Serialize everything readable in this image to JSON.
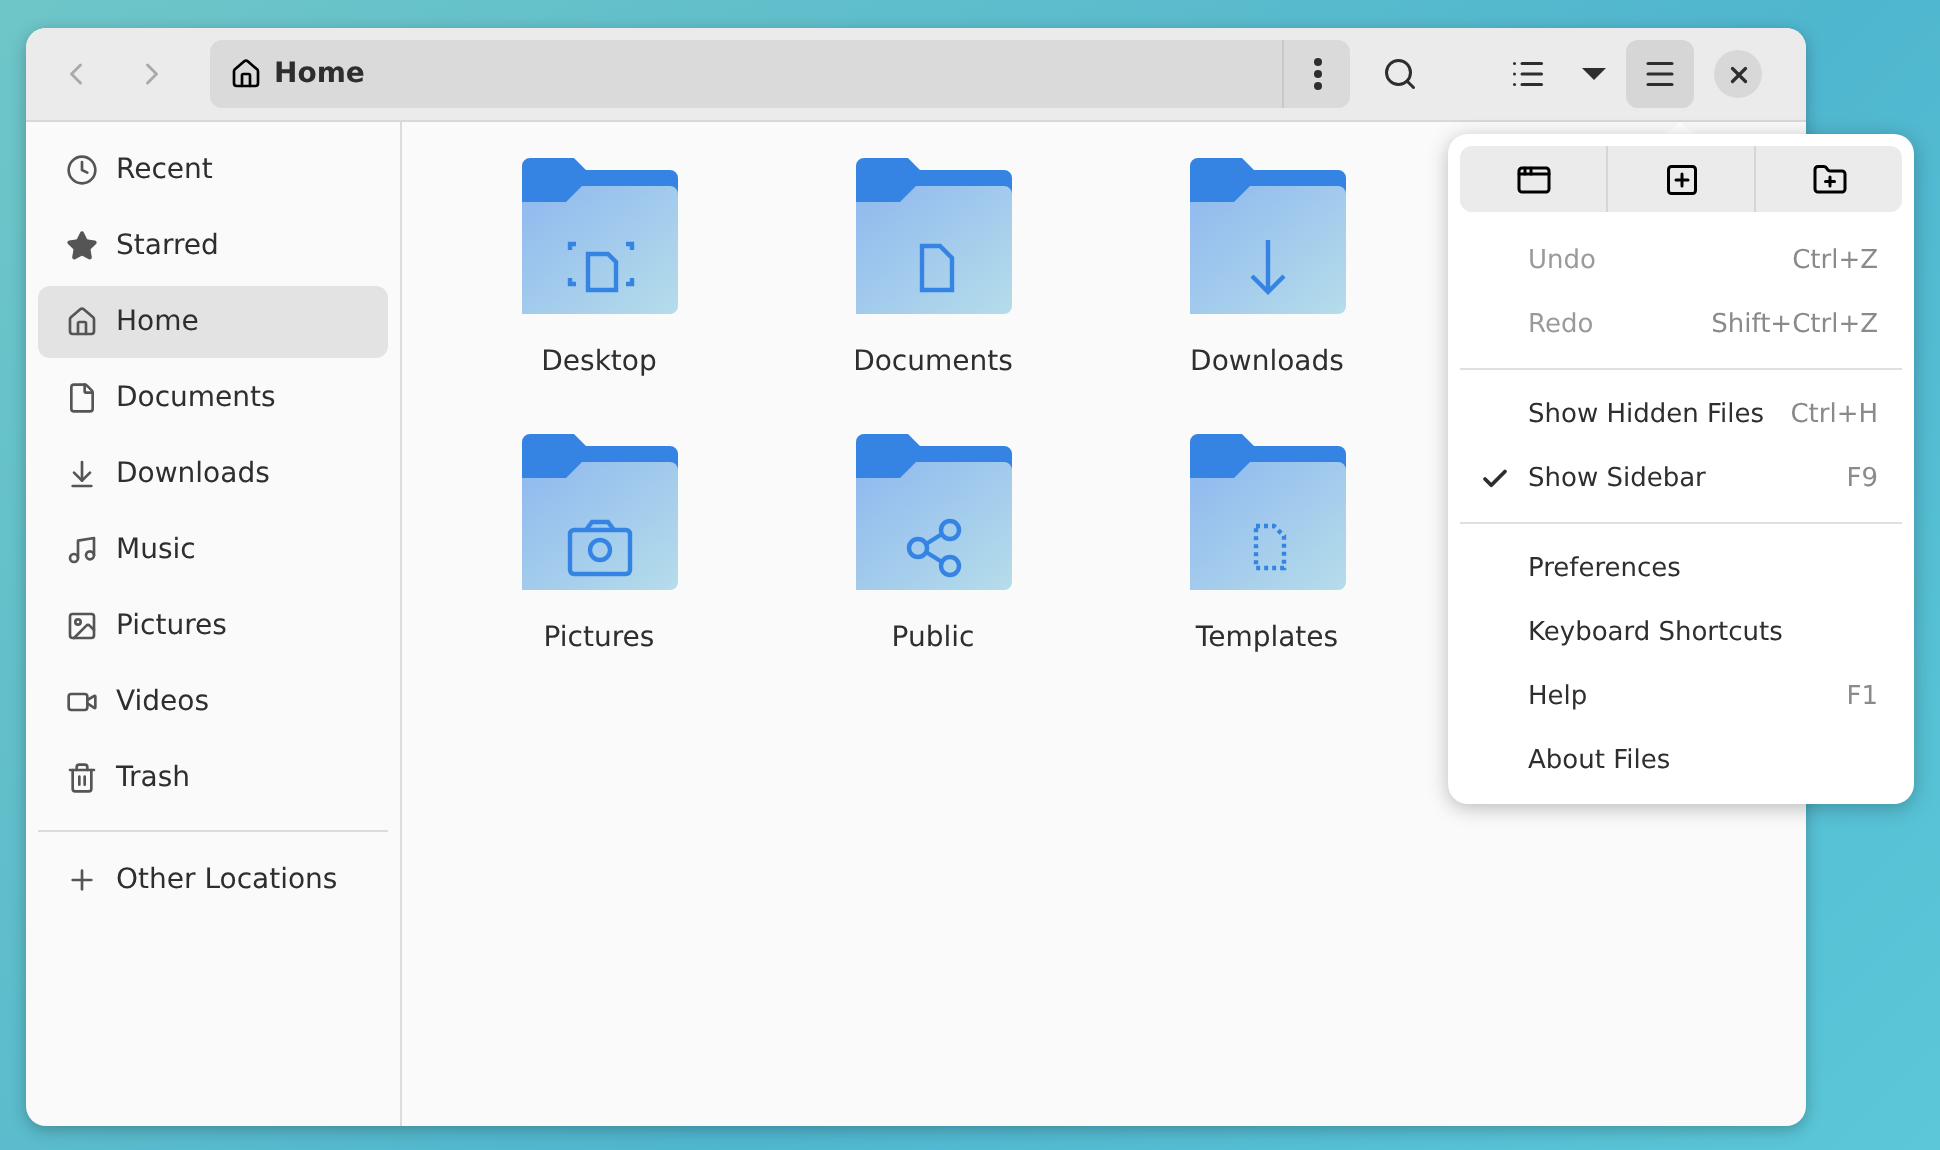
{
  "header": {
    "location": "Home"
  },
  "sidebar": {
    "items": [
      {
        "label": "Recent",
        "kind": "recent",
        "selected": false
      },
      {
        "label": "Starred",
        "kind": "starred",
        "selected": false
      },
      {
        "label": "Home",
        "kind": "home",
        "selected": true
      },
      {
        "label": "Documents",
        "kind": "documents",
        "selected": false
      },
      {
        "label": "Downloads",
        "kind": "downloads",
        "selected": false
      },
      {
        "label": "Music",
        "kind": "music",
        "selected": false
      },
      {
        "label": "Pictures",
        "kind": "pictures",
        "selected": false
      },
      {
        "label": "Videos",
        "kind": "videos",
        "selected": false
      },
      {
        "label": "Trash",
        "kind": "trash",
        "selected": false
      }
    ],
    "other": {
      "label": "Other Locations"
    }
  },
  "folders": [
    {
      "name": "Desktop",
      "kind": "desktop"
    },
    {
      "name": "Documents",
      "kind": "documents"
    },
    {
      "name": "Downloads",
      "kind": "downloads"
    },
    {
      "name": "Pictures",
      "kind": "pictures"
    },
    {
      "name": "Public",
      "kind": "public"
    },
    {
      "name": "Templates",
      "kind": "templates"
    }
  ],
  "menu": {
    "sections": [
      [
        {
          "label": "Undo",
          "shortcut": "Ctrl+Z",
          "disabled": true,
          "checked": false
        },
        {
          "label": "Redo",
          "shortcut": "Shift+Ctrl+Z",
          "disabled": true,
          "checked": false
        }
      ],
      [
        {
          "label": "Show Hidden Files",
          "shortcut": "Ctrl+H",
          "disabled": false,
          "checked": false
        },
        {
          "label": "Show Sidebar",
          "shortcut": "F9",
          "disabled": false,
          "checked": true
        }
      ],
      [
        {
          "label": "Preferences",
          "disabled": false,
          "checked": false
        },
        {
          "label": "Keyboard Shortcuts",
          "disabled": false,
          "checked": false
        },
        {
          "label": "Help",
          "shortcut": "F1",
          "disabled": false,
          "checked": false
        },
        {
          "label": "About Files",
          "disabled": false,
          "checked": false
        }
      ]
    ]
  }
}
